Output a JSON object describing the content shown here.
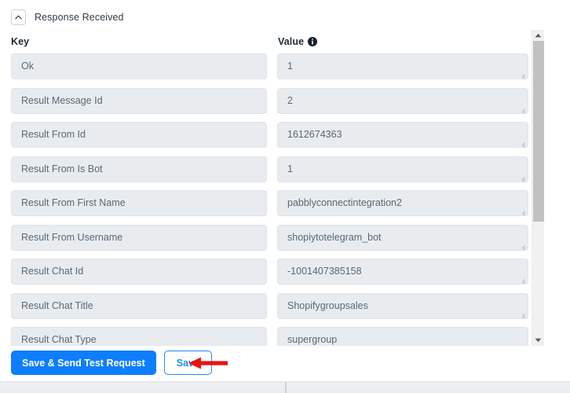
{
  "section": {
    "title": "Response Received",
    "collapse_icon": "chevron-up-icon"
  },
  "columns": {
    "key_label": "Key",
    "value_label": "Value",
    "value_info_icon": "info-icon"
  },
  "rows": [
    {
      "key": "Ok",
      "value": "1"
    },
    {
      "key": "Result Message Id",
      "value": "2"
    },
    {
      "key": "Result From Id",
      "value": "1612674363"
    },
    {
      "key": "Result From Is Bot",
      "value": "1"
    },
    {
      "key": "Result From First Name",
      "value": "pabblyconnectintegration2"
    },
    {
      "key": "Result From Username",
      "value": "shopiytotelegram_bot"
    },
    {
      "key": "Result Chat Id",
      "value": "-1001407385158"
    },
    {
      "key": "Result Chat Title",
      "value": "Shopifygroupsales"
    },
    {
      "key": "Result Chat Type",
      "value": "supergroup"
    }
  ],
  "buttons": {
    "primary_label": "Save & Send Test Request",
    "secondary_label": "Save"
  },
  "scrollbar": {
    "up_arrow_icon": "caret-up-icon",
    "down_arrow_icon": "caret-down-icon"
  },
  "annotation": {
    "arrow_icon": "left-arrow-icon",
    "color": "#ee1111"
  },
  "colors": {
    "primary_button": "#0d7efc",
    "outline_button_text": "#1d8cf8",
    "field_background": "#e9ecef",
    "field_text": "#5a6775",
    "annotation_red": "#ee1111"
  }
}
